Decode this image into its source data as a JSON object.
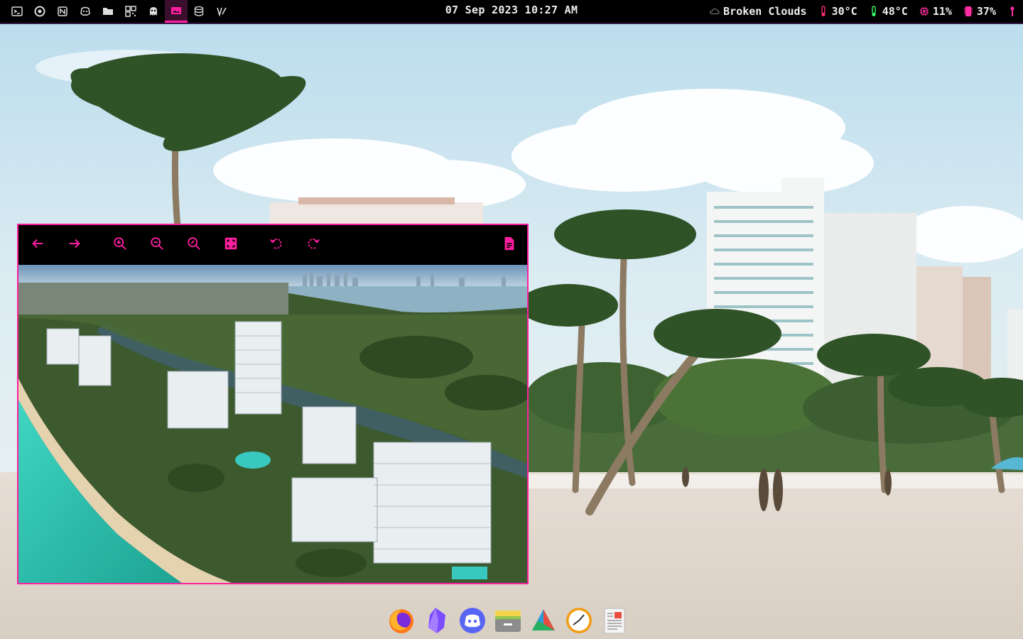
{
  "topbar": {
    "workspaces": [
      {
        "icon": "terminal-icon"
      },
      {
        "icon": "firefox-icon"
      },
      {
        "icon": "notion-icon"
      },
      {
        "icon": "discord-icon"
      },
      {
        "icon": "folder-icon"
      },
      {
        "icon": "qr-code-icon"
      },
      {
        "icon": "ghost-icon"
      },
      {
        "icon": "image-viewer-icon",
        "active": true
      },
      {
        "icon": "database-icon"
      },
      {
        "icon": "editor-icon"
      }
    ],
    "clock": "07 Sep 2023 10:27 AM",
    "weather": {
      "icon": "cloud-icon",
      "text": "Broken Clouds"
    },
    "temperature": {
      "icon": "thermometer-icon",
      "text": "30°C",
      "color": "#ff2f6f"
    },
    "cpu_temp": {
      "icon": "thermometer-icon",
      "text": "48°C",
      "color": "#3cff6a"
    },
    "cpu_usage": {
      "icon": "cpu-icon",
      "text": "11%",
      "color": "#ff2fa3"
    },
    "memory": {
      "icon": "memory-icon",
      "text": "37%",
      "color": "#ff2fa3"
    },
    "power": {
      "icon": "power-icon",
      "color": "#ff2fa3"
    }
  },
  "viewer": {
    "accent": "#ff1fa0",
    "toolbar": [
      {
        "name": "previous-button",
        "icon": "arrow-left-icon"
      },
      {
        "name": "next-button",
        "icon": "arrow-right-icon"
      },
      {
        "name": "zoom-in-button",
        "icon": "zoom-in-icon"
      },
      {
        "name": "zoom-out-button",
        "icon": "zoom-out-icon"
      },
      {
        "name": "zoom-reset-button",
        "icon": "zoom-fit-icon"
      },
      {
        "name": "fit-window-button",
        "icon": "fullscreen-icon"
      },
      {
        "name": "rotate-left-button",
        "icon": "rotate-ccw-icon"
      },
      {
        "name": "rotate-right-button",
        "icon": "rotate-cw-icon"
      },
      {
        "name": "file-info-button",
        "icon": "file-icon"
      }
    ]
  },
  "dock": {
    "apps": [
      {
        "name": "firefox",
        "icon": "firefox-icon"
      },
      {
        "name": "obsidian",
        "icon": "obsidian-icon"
      },
      {
        "name": "discord",
        "icon": "discord-icon"
      },
      {
        "name": "archive-manager",
        "icon": "archive-icon"
      },
      {
        "name": "drive",
        "icon": "drive-icon"
      },
      {
        "name": "clock",
        "icon": "clock-icon"
      },
      {
        "name": "document-viewer",
        "icon": "document-icon"
      }
    ]
  }
}
